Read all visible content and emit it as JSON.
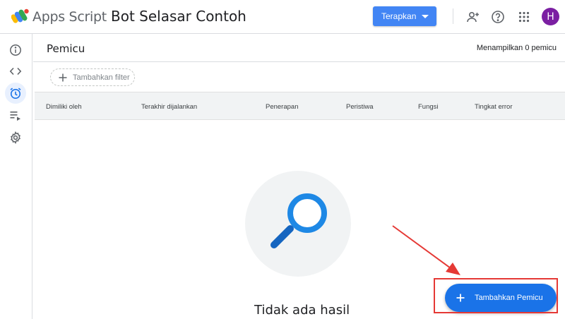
{
  "header": {
    "app_name": "Apps Script",
    "project_title": "Bot Selasar Contoh",
    "deploy_label": "Terapkan",
    "avatar_initial": "H",
    "icons": [
      "add-person-icon",
      "help-icon",
      "apps-grid-icon"
    ]
  },
  "sidebar": {
    "items": [
      {
        "name": "overview",
        "icon": "info-icon"
      },
      {
        "name": "editor",
        "icon": "code-icon"
      },
      {
        "name": "triggers",
        "icon": "alarm-clock-icon",
        "active": true
      },
      {
        "name": "executions",
        "icon": "list-run-icon"
      },
      {
        "name": "settings",
        "icon": "gear-icon"
      }
    ]
  },
  "main": {
    "title": "Pemicu",
    "count_text": "Menampilkan 0 pemicu",
    "filter_label": "Tambahkan filter",
    "columns": [
      "Dimiliki oleh",
      "Terakhir dijalankan",
      "Penerapan",
      "Peristiwa",
      "Fungsi",
      "Tingkat error"
    ],
    "empty_text": "Tidak ada hasil",
    "add_trigger_label": "Tambahkan Pemicu"
  },
  "colors": {
    "accent": "#1a73e8",
    "deploy": "#4285f4",
    "annotation": "#e53935",
    "avatar": "#7b1fa2"
  }
}
